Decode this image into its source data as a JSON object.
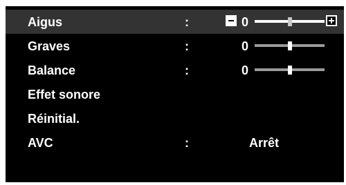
{
  "menu": {
    "items": [
      {
        "label": "Aigus",
        "colon": ":",
        "value": "0",
        "level": 0.5,
        "selected": true
      },
      {
        "label": "Graves",
        "colon": ":",
        "value": "0",
        "level": 0.5,
        "selected": false
      },
      {
        "label": "Balance",
        "colon": ":",
        "value": "0",
        "level": 0.5,
        "selected": false
      },
      {
        "label": "Effet sonore"
      },
      {
        "label": "Réinitial."
      },
      {
        "label": "AVC",
        "colon": ":",
        "value": "Arrêt"
      }
    ]
  },
  "colors": {
    "background": "#000000",
    "selected_row": "#333333",
    "text": "#ffffff",
    "slider_dim": "#9a9a9a"
  },
  "icons": {
    "decrease": "minus-icon",
    "increase": "plus-icon"
  }
}
